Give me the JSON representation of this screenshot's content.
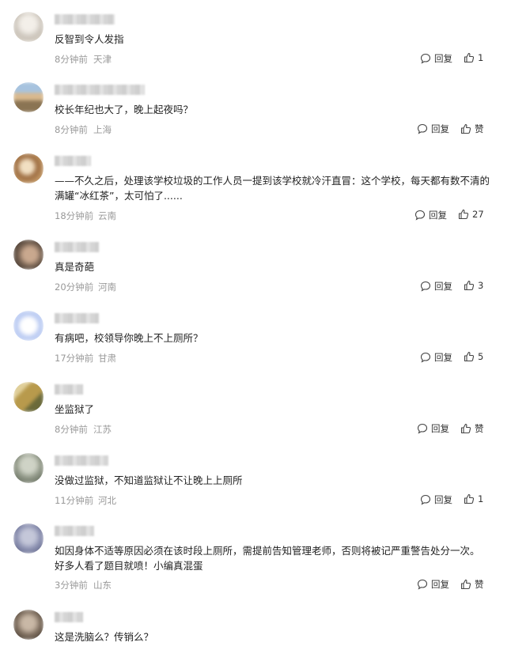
{
  "labels": {
    "reply": "回复"
  },
  "comments": [
    {
      "text": "反智到令人发指",
      "time": "8分钟前",
      "location": "天津",
      "likes": "1",
      "avatar_colors": [
        "#e9e2d6",
        "#c9c2b8",
        "#f3efe9"
      ]
    },
    {
      "text": "校长年纪也大了，晚上起夜吗？",
      "time": "8分钟前",
      "location": "上海",
      "likes": "赞",
      "avatar_colors": [
        "#a7c3df",
        "#8a7453",
        "#d9b98e"
      ]
    },
    {
      "text": "——不久之后，处理该学校垃圾的工作人员一提到该学校就冷汗直冒：这个学校，每天都有数不清的满罐“冰红茶”，太可怕了......",
      "time": "18分钟前",
      "location": "云南",
      "likes": "27",
      "avatar_colors": [
        "#e7c48c",
        "#9c6b3f",
        "#f1dfc2"
      ]
    },
    {
      "text": "真是奇葩",
      "time": "20分钟前",
      "location": "河南",
      "likes": "3",
      "avatar_colors": [
        "#6d5a4b",
        "#c9a88e",
        "#3e342d"
      ]
    },
    {
      "text": "有病吧，校领导你晚上不上厕所？",
      "time": "17分钟前",
      "location": "甘肃",
      "likes": "5",
      "avatar_colors": [
        "#dfe8fb",
        "#b8c9f2",
        "#ffffff"
      ]
    },
    {
      "text": "坐监狱了",
      "time": "8分钟前",
      "location": "江苏",
      "likes": "赞",
      "avatar_colors": [
        "#b89a4c",
        "#6b6a3a",
        "#e0cf9a"
      ]
    },
    {
      "text": "没做过监狱，不知道监狱让不让晚上上厕所",
      "time": "11分钟前",
      "location": "河北",
      "likes": "1",
      "avatar_colors": [
        "#8e9585",
        "#cfd3c6",
        "#5b6354"
      ]
    },
    {
      "text": "如因身体不适等原因必须在该时段上厕所，需提前告知管理老师，否则将被记严重警告处分一次。 好多人看了题目就喷！小编真混蛋",
      "time": "3分钟前",
      "location": "山东",
      "likes": "赞",
      "avatar_colors": [
        "#8a8fb0",
        "#c4c7d9",
        "#565b7c"
      ]
    },
    {
      "text": "这是洗脑么？传销么？",
      "time": "",
      "location": "",
      "likes": "",
      "avatar_colors": [
        "#7a6a5b",
        "#c9b8a6",
        "#3f352c"
      ]
    }
  ]
}
